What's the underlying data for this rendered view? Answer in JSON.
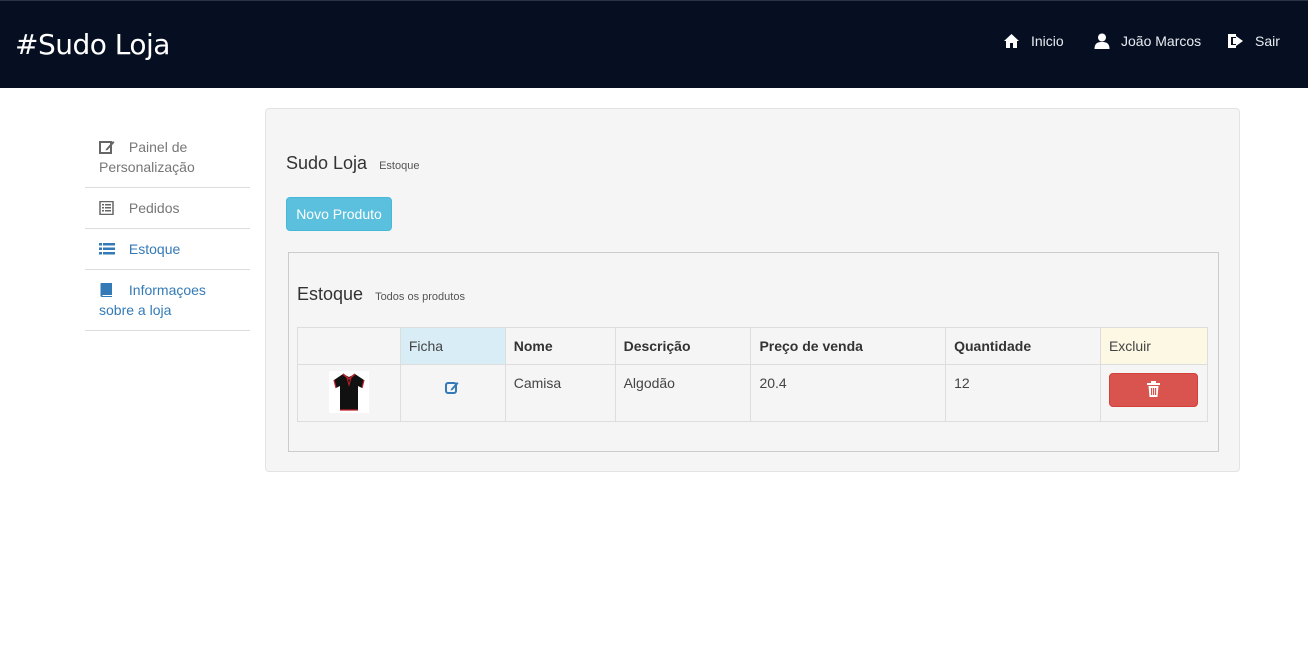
{
  "navbar": {
    "brand": "#Sudo Loja",
    "links": {
      "inicio": "Inicio",
      "user": "João Marcos",
      "sair": "Sair"
    }
  },
  "sidebar": {
    "items": [
      {
        "label": "Painel de Personalização",
        "icon": "edit-icon",
        "state": "muted"
      },
      {
        "label": "Pedidos",
        "icon": "list-alt-icon",
        "state": "muted"
      },
      {
        "label": "Estoque",
        "icon": "list-icon",
        "state": "active"
      },
      {
        "label": "Informaçoes sobre a loja",
        "icon": "book-icon",
        "state": "link"
      }
    ]
  },
  "main": {
    "title": "Sudo Loja",
    "subtitle": "Estoque",
    "new_button": "Novo Produto",
    "panel": {
      "title": "Estoque",
      "subtitle": "Todos os produtos",
      "columns": [
        "",
        "Ficha",
        "Nome",
        "Descrição",
        "Preço de venda",
        "Quantidade",
        "Excluir"
      ],
      "rows": [
        {
          "image": "black polo shirt thumbnail",
          "nome": "Camisa",
          "descricao": "Algodão",
          "preco": "20.4",
          "quantidade": "12"
        }
      ]
    }
  },
  "colors": {
    "navbar_bg": "#060f21",
    "accent": "#337ab7",
    "info_button": "#5bc0de",
    "danger_button": "#d9534f"
  }
}
